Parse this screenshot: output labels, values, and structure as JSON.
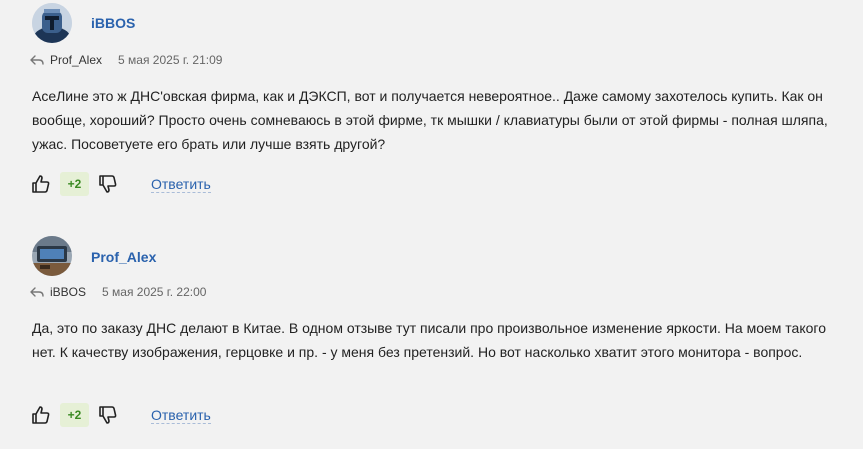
{
  "comments": [
    {
      "author": "iBBOS",
      "reply_to": "Prof_Alex",
      "date": "5 мая 2025 г. 21:09",
      "text": "АсеЛине это ж ДНС'овская фирма, как и ДЭКСП, вот и получается невероятное.. Даже самому захотелось купить. Как он вообще, хороший? Просто очень сомневаюсь в этой фирме, тк мышки / клавиатуры были от этой фирмы - полная шляпа, ужас. Посоветуете его брать или лучше взять другой?",
      "score": "+2",
      "reply_label": "Ответить",
      "avatar_icon": "robot-avatar"
    },
    {
      "author": "Prof_Alex",
      "reply_to": "iBBOS",
      "date": "5 мая 2025 г. 22:00",
      "text": "Да, это по заказу ДНС делают в Китае. В одном отзыве тут писали про произвольное изменение яркости. На моем такого нет. К качеству изображения, герцовке и пр. - у меня без претензий. Но вот насколько хватит этого монитора - вопрос.",
      "score": "+2",
      "reply_label": "Ответить",
      "avatar_icon": "desk-avatar"
    }
  ],
  "colors": {
    "background": "#f2f2f2",
    "link": "#2a62ad",
    "score_bg": "#e6f0d6",
    "score_text": "#3a8a22"
  },
  "icons": {
    "reply": "reply-arrow-icon",
    "like": "thumb-up-icon",
    "dislike": "thumb-down-icon"
  }
}
